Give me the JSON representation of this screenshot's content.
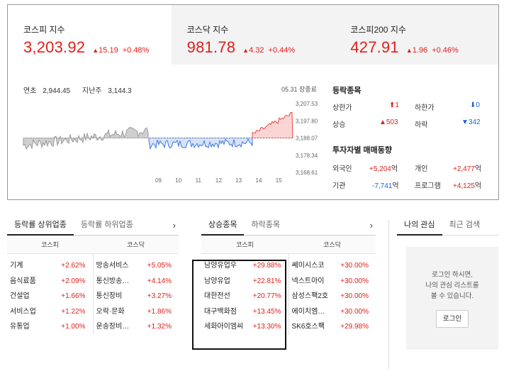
{
  "indices": [
    {
      "name": "코스피 지수",
      "value": "3,203.92",
      "change": "15.19",
      "pct": "+0.48%"
    },
    {
      "name": "코스닥 지수",
      "value": "981.78",
      "change": "4.32",
      "pct": "+0.44%"
    },
    {
      "name": "코스피200 지수",
      "value": "427.91",
      "change": "1.96",
      "pct": "+0.46%"
    }
  ],
  "chart": {
    "year_high_label": "연초",
    "year_high": "2,944.45",
    "last_week_label": "지난주",
    "last_week": "3,144.3",
    "close_label": "05.31 장종료",
    "yticks": [
      "3,207.53",
      "3,197.80",
      "3,188.07",
      "3,178.34",
      "3,168.61"
    ],
    "xticks": [
      "09",
      "10",
      "11",
      "12",
      "13",
      "14",
      "15"
    ]
  },
  "chart_data": {
    "type": "area",
    "x": [
      "09",
      "10",
      "11",
      "12",
      "13",
      "14",
      "15"
    ],
    "ylim": [
      3168.61,
      3207.53
    ],
    "baseline": 3188.07,
    "series": [
      {
        "values": [
          3190.5,
          3188.7,
          3184.5,
          3182.5,
          3187.1,
          3187.7,
          3186.6,
          3195.8,
          3198.0,
          3202.0
        ]
      }
    ]
  },
  "updown": {
    "title": "등락종목",
    "limit_up_label": "상한가",
    "limit_up": "1",
    "limit_down_label": "하한가",
    "limit_down": "0",
    "up_label": "상승",
    "up": "503",
    "down_label": "하락",
    "down": "342"
  },
  "investors": {
    "title": "투자자별 매매동향",
    "foreign_label": "외국인",
    "foreign": "+5,204",
    "individual_label": "개인",
    "individual": "+2,477",
    "inst_label": "기관",
    "inst": "-7,741",
    "program_label": "프로그램",
    "program": "+4,125",
    "unit": "억"
  },
  "sector": {
    "tab_on": "등락률 상위업종",
    "tab_off": "등락률 하위업종",
    "arrow": "›",
    "sub1": "코스피",
    "sub2": "코스닥",
    "col1": [
      {
        "name": "기계",
        "pct": "+2.62%"
      },
      {
        "name": "음식료품",
        "pct": "+2.09%"
      },
      {
        "name": "건설업",
        "pct": "+1.66%"
      },
      {
        "name": "서비스업",
        "pct": "+1.22%"
      },
      {
        "name": "유통업",
        "pct": "+1.00%"
      }
    ],
    "col2": [
      {
        "name": "방송서비스",
        "pct": "+5.05%"
      },
      {
        "name": "통신방송…",
        "pct": "+4.14%"
      },
      {
        "name": "통신장비",
        "pct": "+3.27%"
      },
      {
        "name": "오락·문화",
        "pct": "+1.86%"
      },
      {
        "name": "운송장비…",
        "pct": "+1.32%"
      }
    ]
  },
  "stocks": {
    "tab_on": "상승종목",
    "tab_off": "하락종목",
    "arrow": "›",
    "sub1": "코스피",
    "sub2": "코스닥",
    "col1": [
      {
        "name": "남양유업우",
        "pct": "+29.88%"
      },
      {
        "name": "남양유업",
        "pct": "+22.81%"
      },
      {
        "name": "대한전선",
        "pct": "+20.77%"
      },
      {
        "name": "대구백화점",
        "pct": "+13.45%"
      },
      {
        "name": "세화아이엠씨",
        "pct": "+13.30%"
      }
    ],
    "col2": [
      {
        "name": "쎄미시스코",
        "pct": "+30.00%"
      },
      {
        "name": "넥스트아이",
        "pct": "+30.00%"
      },
      {
        "name": "삼성스팩2호",
        "pct": "+30.00%"
      },
      {
        "name": "에이치엠…",
        "pct": "+30.00%"
      },
      {
        "name": "SK6호스팩",
        "pct": "+29.98%"
      }
    ]
  },
  "mypanel": {
    "tab_on": "나의 관심",
    "tab_off": "최근 검색",
    "msg1": "로그인 하시면,",
    "msg2": "나의 관심 리스트를",
    "msg3": "볼 수 있습니다.",
    "login": "로그인"
  }
}
